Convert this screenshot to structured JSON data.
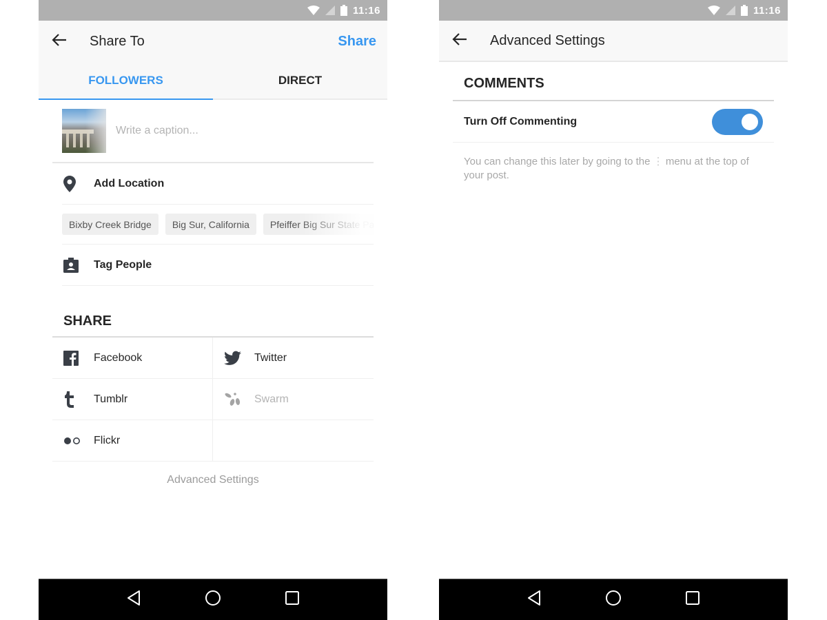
{
  "status_bar": {
    "time": "11:16",
    "icons": [
      "wifi-icon",
      "signal-icon",
      "battery-icon"
    ]
  },
  "share_screen": {
    "title": "Share To",
    "action_label": "Share",
    "back_icon": "arrow-left-icon",
    "tabs": [
      {
        "label": "FOLLOWERS",
        "active": true
      },
      {
        "label": "DIRECT",
        "active": false
      }
    ],
    "caption": {
      "placeholder": "Write a caption...",
      "value": "",
      "thumbnail": "bridge-photo-thumbnail"
    },
    "add_location": {
      "label": "Add Location",
      "icon": "location-pin-icon"
    },
    "location_suggestions": [
      "Bixby Creek Bridge",
      "Big Sur, California",
      "Pfeiffer Big Sur State Park"
    ],
    "tag_people": {
      "label": "Tag People",
      "icon": "tag-person-icon"
    },
    "share_section": {
      "header": "SHARE",
      "services": [
        {
          "label": "Facebook",
          "icon": "facebook-icon",
          "enabled": true
        },
        {
          "label": "Twitter",
          "icon": "twitter-icon",
          "enabled": true
        },
        {
          "label": "Tumblr",
          "icon": "tumblr-icon",
          "enabled": true
        },
        {
          "label": "Swarm",
          "icon": "swarm-icon",
          "enabled": false
        },
        {
          "label": "Flickr",
          "icon": "flickr-icon",
          "enabled": true
        }
      ]
    },
    "advanced_settings_link": "Advanced Settings"
  },
  "advanced_screen": {
    "title": "Advanced Settings",
    "back_icon": "arrow-left-icon",
    "comments_header": "COMMENTS",
    "toggle": {
      "label": "Turn Off Commenting",
      "on": true
    },
    "help_text_before": "You can change this later by going to the",
    "help_menu_glyph": "⋮",
    "help_text_after": "menu at the top of your post."
  },
  "nav_bar": {
    "buttons": [
      "back-triangle-icon",
      "home-circle-icon",
      "recents-square-icon"
    ]
  },
  "colors": {
    "accent": "#3897f0",
    "toggle_on": "#3f8fda",
    "status_bar": "#b0b0b0",
    "nav_bar": "#000000"
  }
}
